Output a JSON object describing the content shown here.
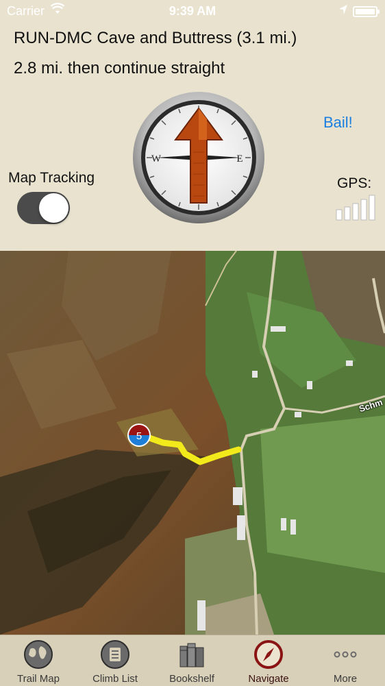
{
  "status_bar": {
    "carrier": "Carrier",
    "time": "9:39 AM",
    "icons": [
      "wifi-icon",
      "location-arrow-icon",
      "battery-icon"
    ]
  },
  "header": {
    "route_title": "RUN-DMC Cave and Buttress (3.1 mi.)",
    "direction": "2.8 mi. then continue straight",
    "bail_label": "Bail!",
    "map_tracking_label": "Map Tracking",
    "map_tracking_on": true,
    "gps_label": "GPS:",
    "gps_signal_bars": 5
  },
  "compass": {
    "west_label": "W",
    "east_label": "E",
    "arrow_color": "#b8480f",
    "heading": "straight ahead"
  },
  "map": {
    "marker_number": "5",
    "route_color": "#f2ea1a",
    "road_label": "Schm"
  },
  "tabs": [
    {
      "label": "Trail Map",
      "icon": "globe-icon",
      "active": false
    },
    {
      "label": "Climb List",
      "icon": "list-icon",
      "active": false
    },
    {
      "label": "Bookshelf",
      "icon": "books-icon",
      "active": false
    },
    {
      "label": "Navigate",
      "icon": "compass-icon",
      "active": true
    },
    {
      "label": "More",
      "icon": "more-dots-icon",
      "active": false
    }
  ],
  "colors": {
    "header_bg": "#e8e2cf",
    "tabbar_bg": "#d8d0b8",
    "link_blue": "#1a7fe0",
    "active_tab": "#8a1414"
  }
}
